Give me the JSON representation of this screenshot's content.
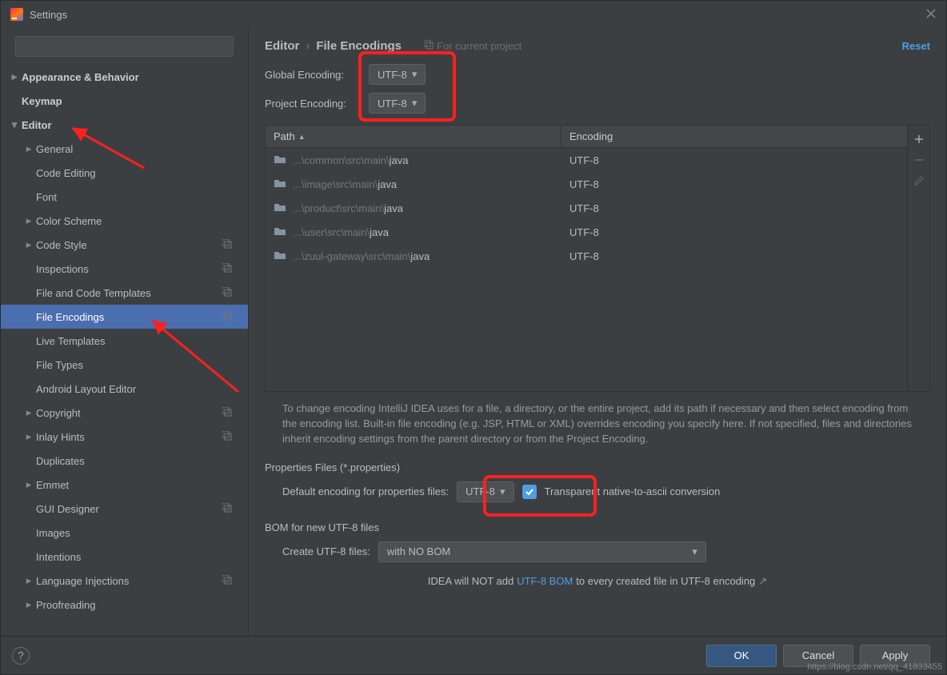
{
  "window": {
    "title": "Settings"
  },
  "search": {
    "placeholder": ""
  },
  "sidebar": [
    {
      "label": "Appearance & Behavior",
      "arrow": "right",
      "bold": true,
      "depth": 0
    },
    {
      "label": "Keymap",
      "bold": true,
      "depth": 0
    },
    {
      "label": "Editor",
      "arrow": "down",
      "bold": true,
      "depth": 0
    },
    {
      "label": "General",
      "arrow": "right",
      "depth": 1
    },
    {
      "label": "Code Editing",
      "depth": 1
    },
    {
      "label": "Font",
      "depth": 1
    },
    {
      "label": "Color Scheme",
      "arrow": "right",
      "depth": 1
    },
    {
      "label": "Code Style",
      "arrow": "right",
      "depth": 1,
      "copy": true
    },
    {
      "label": "Inspections",
      "depth": 1,
      "copy": true
    },
    {
      "label": "File and Code Templates",
      "depth": 1,
      "copy": true
    },
    {
      "label": "File Encodings",
      "depth": 1,
      "copy": true,
      "selected": true
    },
    {
      "label": "Live Templates",
      "depth": 1
    },
    {
      "label": "File Types",
      "depth": 1
    },
    {
      "label": "Android Layout Editor",
      "depth": 1
    },
    {
      "label": "Copyright",
      "arrow": "right",
      "depth": 1,
      "copy": true
    },
    {
      "label": "Inlay Hints",
      "arrow": "right",
      "depth": 1,
      "copy": true
    },
    {
      "label": "Duplicates",
      "depth": 1
    },
    {
      "label": "Emmet",
      "arrow": "right",
      "depth": 1
    },
    {
      "label": "GUI Designer",
      "depth": 1,
      "copy": true
    },
    {
      "label": "Images",
      "depth": 1
    },
    {
      "label": "Intentions",
      "depth": 1
    },
    {
      "label": "Language Injections",
      "arrow": "right",
      "depth": 1,
      "copy": true
    },
    {
      "label": "Proofreading",
      "arrow": "right",
      "depth": 1
    }
  ],
  "breadcrumb": {
    "a": "Editor",
    "b": "File Encodings",
    "forProject": "For current project"
  },
  "resetLabel": "Reset",
  "globalEncoding": {
    "label": "Global Encoding:",
    "value": "UTF-8"
  },
  "projectEncoding": {
    "label": "Project Encoding:",
    "value": "UTF-8"
  },
  "tableHeaders": {
    "path": "Path",
    "encoding": "Encoding"
  },
  "rows": [
    {
      "muted": "...\\common\\src\\main\\",
      "strong": "java",
      "encoding": "UTF-8"
    },
    {
      "muted": "...\\image\\src\\main\\",
      "strong": "java",
      "encoding": "UTF-8"
    },
    {
      "muted": "...\\product\\src\\main\\",
      "strong": "java",
      "encoding": "UTF-8"
    },
    {
      "muted": "...\\user\\src\\main\\",
      "strong": "java",
      "encoding": "UTF-8"
    },
    {
      "muted": "...\\zuul-gateway\\src\\main\\",
      "strong": "java",
      "encoding": "UTF-8"
    }
  ],
  "info": "To change encoding IntelliJ IDEA uses for a file, a directory, or the entire project, add its path if necessary and then select encoding from the encoding list. Built-in file encoding (e.g. JSP, HTML or XML) overrides encoding you specify here. If not specified, files and directories inherit encoding settings from the parent directory or from the Project Encoding.",
  "props": {
    "title": "Properties Files (*.properties)",
    "label": "Default encoding for properties files:",
    "value": "UTF-8",
    "checkboxLabel": "Transparent native-to-ascii conversion"
  },
  "bom": {
    "title": "BOM for new UTF-8 files",
    "label": "Create UTF-8 files:",
    "value": "with NO BOM",
    "notePre": "IDEA will NOT add",
    "noteLink": "UTF-8 BOM",
    "notePost": "to every created file in UTF-8 encoding"
  },
  "buttons": {
    "ok": "OK",
    "cancel": "Cancel",
    "apply": "Apply"
  },
  "watermark": "https://blog.csdn.net/qq_41833455"
}
